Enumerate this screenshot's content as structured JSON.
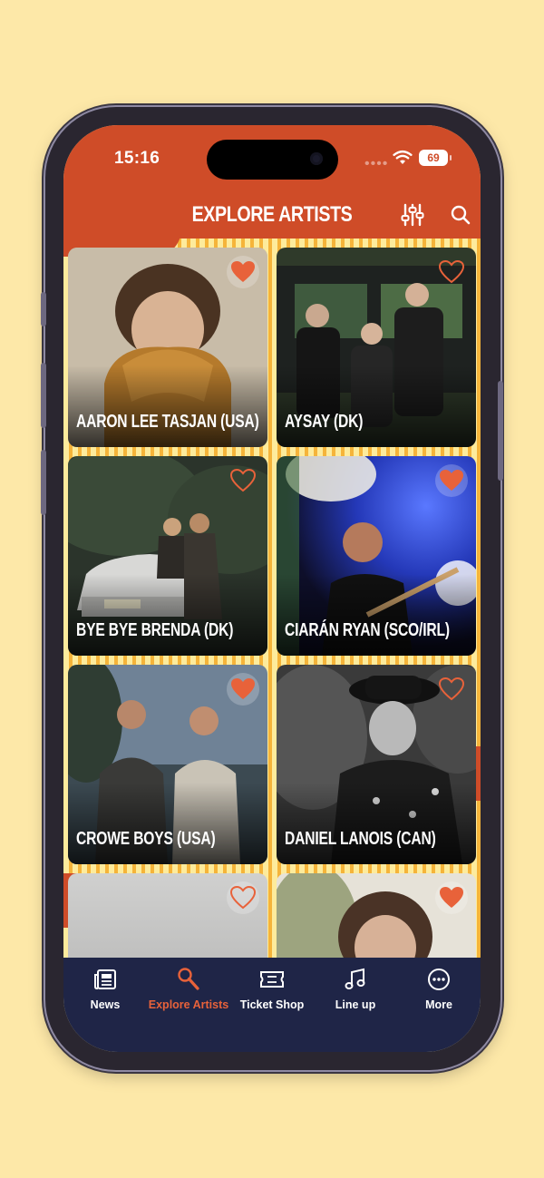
{
  "status_bar": {
    "time": "15:16",
    "battery": "69"
  },
  "header": {
    "title": "EXPLORE ARTISTS",
    "filter_icon": "sliders-icon",
    "search_icon": "search-icon"
  },
  "colors": {
    "brand": "#cf4c28",
    "background": "#fdeb9c",
    "stripe": "#f5b43a",
    "tabbar": "#1f2547",
    "active_tab": "#e8623a",
    "heart": "#e8623a"
  },
  "artists": [
    {
      "name": "AARON LEE TASJAN (USA)",
      "favorited": true
    },
    {
      "name": "AYSAY (DK)",
      "favorited": false
    },
    {
      "name": "BYE BYE BRENDA (DK)",
      "favorited": false
    },
    {
      "name": "CIARÁN RYAN (SCO/IRL)",
      "favorited": true
    },
    {
      "name": "CROWE BOYS (USA)",
      "favorited": true
    },
    {
      "name": "DANIEL LANOIS (CAN)",
      "favorited": false
    },
    {
      "name": "",
      "favorited": false
    },
    {
      "name": "",
      "favorited": true
    }
  ],
  "tabs": [
    {
      "label": "News",
      "icon": "newspaper-icon",
      "active": false
    },
    {
      "label": "Explore Artists",
      "icon": "guitar-search-icon",
      "active": true
    },
    {
      "label": "Ticket Shop",
      "icon": "ticket-icon",
      "active": false
    },
    {
      "label": "Line up",
      "icon": "music-note-icon",
      "active": false
    },
    {
      "label": "More",
      "icon": "more-icon",
      "active": false
    }
  ]
}
